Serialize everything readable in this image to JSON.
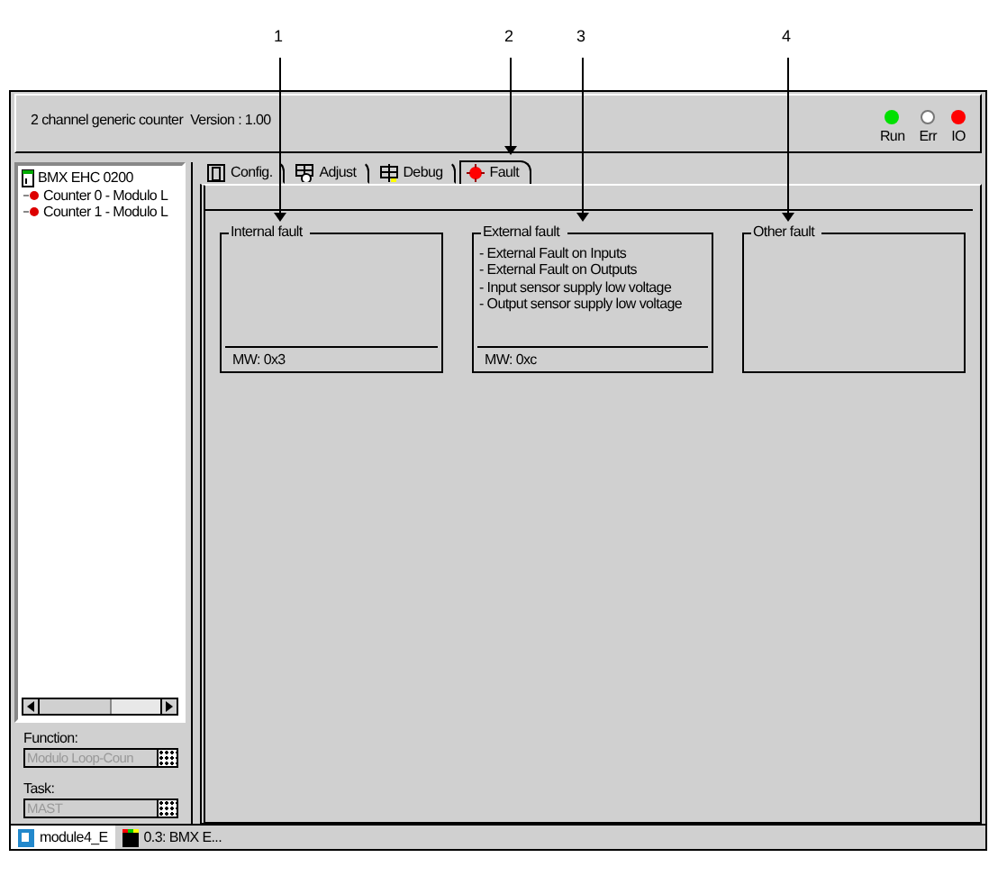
{
  "callouts": [
    {
      "label": "1"
    },
    {
      "label": "2"
    },
    {
      "label": "3"
    },
    {
      "label": "4"
    }
  ],
  "header": {
    "title": "2 channel generic counter",
    "version": "Version : 1.00"
  },
  "leds": [
    {
      "label": "Run",
      "on": true,
      "color": "#00e000"
    },
    {
      "label": "Err",
      "on": false
    },
    {
      "label": "IO",
      "on": true,
      "color": "#ff0000"
    }
  ],
  "tree": {
    "label": "BMX EHC 0200",
    "children": [
      {
        "label": "Counter 0 - Modulo L"
      },
      {
        "label": "Counter 1 - Modulo L"
      }
    ]
  },
  "function": {
    "label": "Function:",
    "value": "Modulo Loop-Coun",
    "disabled": true
  },
  "task": {
    "label": "Task:",
    "value": "MAST",
    "disabled": true
  },
  "tabs": [
    {
      "label": "Config.",
      "kind": "config",
      "selected": false
    },
    {
      "label": "Adjust",
      "kind": "adjust",
      "selected": false
    },
    {
      "label": "Debug",
      "kind": "debug",
      "selected": false
    },
    {
      "label": "Fault",
      "kind": "fault",
      "selected": true
    }
  ],
  "fault_groups": [
    {
      "title": "Internal fault",
      "footer": "MW: 0x3"
    },
    {
      "title": "External fault",
      "items": [
        "- External Fault on Inputs",
        "- External Fault on Outputs",
        "- Input sensor supply low voltage",
        "- Output sensor supply low voltage"
      ],
      "footer": "MW: 0xc"
    },
    {
      "title": "Other fault"
    }
  ],
  "taskbar": [
    {
      "label": "module4_E",
      "selected": true
    },
    {
      "label": "0.3: BMX E...",
      "selected": false
    }
  ]
}
